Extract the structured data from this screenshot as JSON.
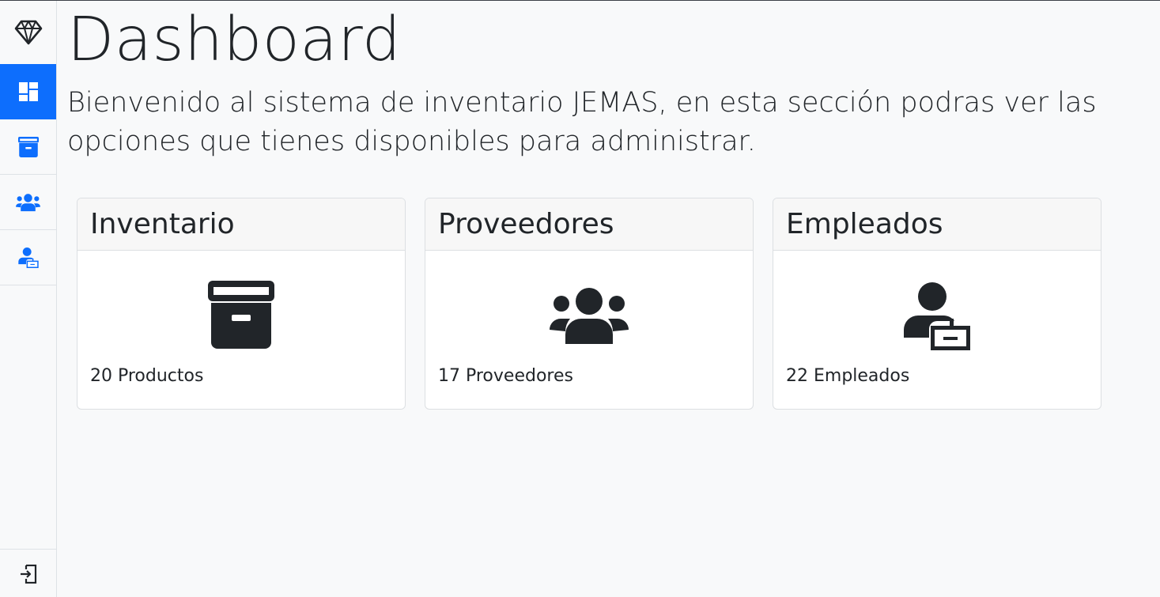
{
  "sidebar": {
    "brand_icon": "gem-icon",
    "items": [
      {
        "icon": "dashboard-icon",
        "active": true
      },
      {
        "icon": "archive-box-icon",
        "active": false
      },
      {
        "icon": "users-icon",
        "active": false
      },
      {
        "icon": "employee-badge-icon",
        "active": false
      }
    ],
    "logout_icon": "sign-out-icon"
  },
  "header": {
    "title": "Dashboard",
    "lead": "Bienvenido al sistema de inventario JEMAS, en esta sección podras ver las opciones que tienes disponibles para administrar."
  },
  "cards": [
    {
      "title": "Inventario",
      "icon": "archive-box-icon",
      "count_label": "20 Productos"
    },
    {
      "title": "Proveedores",
      "icon": "users-icon",
      "count_label": "17 Proveedores"
    },
    {
      "title": "Empleados",
      "icon": "employee-badge-icon",
      "count_label": "22 Empleados"
    }
  ],
  "colors": {
    "accent": "#0d6efd",
    "text": "#212529",
    "background": "#f8f9fa"
  }
}
